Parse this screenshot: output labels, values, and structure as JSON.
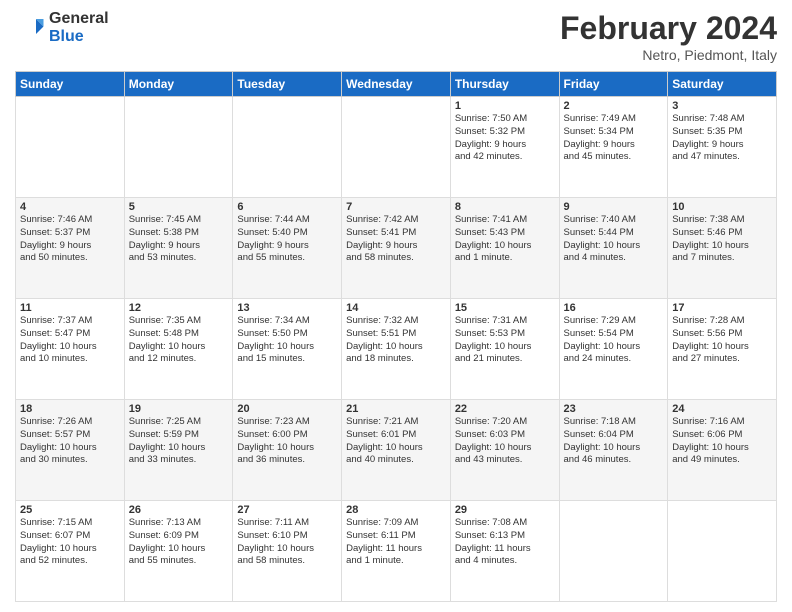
{
  "header": {
    "logo_general": "General",
    "logo_blue": "Blue",
    "title": "February 2024",
    "subtitle": "Netro, Piedmont, Italy"
  },
  "days_of_week": [
    "Sunday",
    "Monday",
    "Tuesday",
    "Wednesday",
    "Thursday",
    "Friday",
    "Saturday"
  ],
  "weeks": [
    [
      {
        "day": "",
        "info": ""
      },
      {
        "day": "",
        "info": ""
      },
      {
        "day": "",
        "info": ""
      },
      {
        "day": "",
        "info": ""
      },
      {
        "day": "1",
        "info": "Sunrise: 7:50 AM\nSunset: 5:32 PM\nDaylight: 9 hours\nand 42 minutes."
      },
      {
        "day": "2",
        "info": "Sunrise: 7:49 AM\nSunset: 5:34 PM\nDaylight: 9 hours\nand 45 minutes."
      },
      {
        "day": "3",
        "info": "Sunrise: 7:48 AM\nSunset: 5:35 PM\nDaylight: 9 hours\nand 47 minutes."
      }
    ],
    [
      {
        "day": "4",
        "info": "Sunrise: 7:46 AM\nSunset: 5:37 PM\nDaylight: 9 hours\nand 50 minutes."
      },
      {
        "day": "5",
        "info": "Sunrise: 7:45 AM\nSunset: 5:38 PM\nDaylight: 9 hours\nand 53 minutes."
      },
      {
        "day": "6",
        "info": "Sunrise: 7:44 AM\nSunset: 5:40 PM\nDaylight: 9 hours\nand 55 minutes."
      },
      {
        "day": "7",
        "info": "Sunrise: 7:42 AM\nSunset: 5:41 PM\nDaylight: 9 hours\nand 58 minutes."
      },
      {
        "day": "8",
        "info": "Sunrise: 7:41 AM\nSunset: 5:43 PM\nDaylight: 10 hours\nand 1 minute."
      },
      {
        "day": "9",
        "info": "Sunrise: 7:40 AM\nSunset: 5:44 PM\nDaylight: 10 hours\nand 4 minutes."
      },
      {
        "day": "10",
        "info": "Sunrise: 7:38 AM\nSunset: 5:46 PM\nDaylight: 10 hours\nand 7 minutes."
      }
    ],
    [
      {
        "day": "11",
        "info": "Sunrise: 7:37 AM\nSunset: 5:47 PM\nDaylight: 10 hours\nand 10 minutes."
      },
      {
        "day": "12",
        "info": "Sunrise: 7:35 AM\nSunset: 5:48 PM\nDaylight: 10 hours\nand 12 minutes."
      },
      {
        "day": "13",
        "info": "Sunrise: 7:34 AM\nSunset: 5:50 PM\nDaylight: 10 hours\nand 15 minutes."
      },
      {
        "day": "14",
        "info": "Sunrise: 7:32 AM\nSunset: 5:51 PM\nDaylight: 10 hours\nand 18 minutes."
      },
      {
        "day": "15",
        "info": "Sunrise: 7:31 AM\nSunset: 5:53 PM\nDaylight: 10 hours\nand 21 minutes."
      },
      {
        "day": "16",
        "info": "Sunrise: 7:29 AM\nSunset: 5:54 PM\nDaylight: 10 hours\nand 24 minutes."
      },
      {
        "day": "17",
        "info": "Sunrise: 7:28 AM\nSunset: 5:56 PM\nDaylight: 10 hours\nand 27 minutes."
      }
    ],
    [
      {
        "day": "18",
        "info": "Sunrise: 7:26 AM\nSunset: 5:57 PM\nDaylight: 10 hours\nand 30 minutes."
      },
      {
        "day": "19",
        "info": "Sunrise: 7:25 AM\nSunset: 5:59 PM\nDaylight: 10 hours\nand 33 minutes."
      },
      {
        "day": "20",
        "info": "Sunrise: 7:23 AM\nSunset: 6:00 PM\nDaylight: 10 hours\nand 36 minutes."
      },
      {
        "day": "21",
        "info": "Sunrise: 7:21 AM\nSunset: 6:01 PM\nDaylight: 10 hours\nand 40 minutes."
      },
      {
        "day": "22",
        "info": "Sunrise: 7:20 AM\nSunset: 6:03 PM\nDaylight: 10 hours\nand 43 minutes."
      },
      {
        "day": "23",
        "info": "Sunrise: 7:18 AM\nSunset: 6:04 PM\nDaylight: 10 hours\nand 46 minutes."
      },
      {
        "day": "24",
        "info": "Sunrise: 7:16 AM\nSunset: 6:06 PM\nDaylight: 10 hours\nand 49 minutes."
      }
    ],
    [
      {
        "day": "25",
        "info": "Sunrise: 7:15 AM\nSunset: 6:07 PM\nDaylight: 10 hours\nand 52 minutes."
      },
      {
        "day": "26",
        "info": "Sunrise: 7:13 AM\nSunset: 6:09 PM\nDaylight: 10 hours\nand 55 minutes."
      },
      {
        "day": "27",
        "info": "Sunrise: 7:11 AM\nSunset: 6:10 PM\nDaylight: 10 hours\nand 58 minutes."
      },
      {
        "day": "28",
        "info": "Sunrise: 7:09 AM\nSunset: 6:11 PM\nDaylight: 11 hours\nand 1 minute."
      },
      {
        "day": "29",
        "info": "Sunrise: 7:08 AM\nSunset: 6:13 PM\nDaylight: 11 hours\nand 4 minutes."
      },
      {
        "day": "",
        "info": ""
      },
      {
        "day": "",
        "info": ""
      }
    ]
  ]
}
